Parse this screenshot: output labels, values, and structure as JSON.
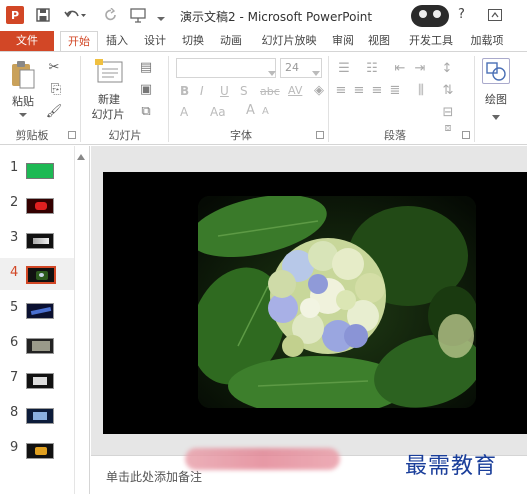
{
  "window": {
    "title": "演示文稿2 - Microsoft PowerPoint",
    "app_badge": "P",
    "help": "?",
    "colors": {
      "accent": "#d24726",
      "file_tab_bg": "#d24726",
      "slide_bg": "#000000",
      "watermark": "#1a3e9a"
    }
  },
  "quick_access": {
    "icons": [
      "powerpoint-logo-icon",
      "save-icon",
      "undo-icon",
      "redo-icon",
      "start-from-beginning-icon"
    ]
  },
  "tabs": [
    {
      "label": "文件",
      "active": false
    },
    {
      "label": "开始",
      "active": true
    },
    {
      "label": "插入"
    },
    {
      "label": "设计"
    },
    {
      "label": "切换"
    },
    {
      "label": "动画"
    },
    {
      "label": "幻灯片放映"
    },
    {
      "label": "审阅"
    },
    {
      "label": "视图"
    },
    {
      "label": "开发工具"
    },
    {
      "label": "加载项"
    }
  ],
  "ribbon": {
    "clipboard": {
      "paste_label": "粘贴",
      "group_label": "剪贴板"
    },
    "slides": {
      "new_slide_line1": "新建",
      "new_slide_line2": "幻灯片",
      "group_label": "幻灯片"
    },
    "font": {
      "font_size": "24",
      "group_label": "字体",
      "bold": "B",
      "italic": "I",
      "underline": "U",
      "strike": "S",
      "abc": "abc",
      "av": "AV",
      "aa": "Aa",
      "a_color": "A",
      "grow": "A",
      "shrink": "A"
    },
    "paragraph": {
      "group_label": "段落"
    },
    "drawing": {
      "label": "绘图"
    }
  },
  "slides_panel": {
    "slides": [
      {
        "number": "1",
        "selected": false
      },
      {
        "number": "2",
        "selected": false
      },
      {
        "number": "3",
        "selected": false
      },
      {
        "number": "4",
        "selected": true
      },
      {
        "number": "5",
        "selected": false
      },
      {
        "number": "6",
        "selected": false
      },
      {
        "number": "7",
        "selected": false
      },
      {
        "number": "8",
        "selected": false
      },
      {
        "number": "9",
        "selected": false
      }
    ]
  },
  "notes": {
    "placeholder": "单击此处添加备注"
  },
  "watermark": {
    "text": "最需教育"
  }
}
